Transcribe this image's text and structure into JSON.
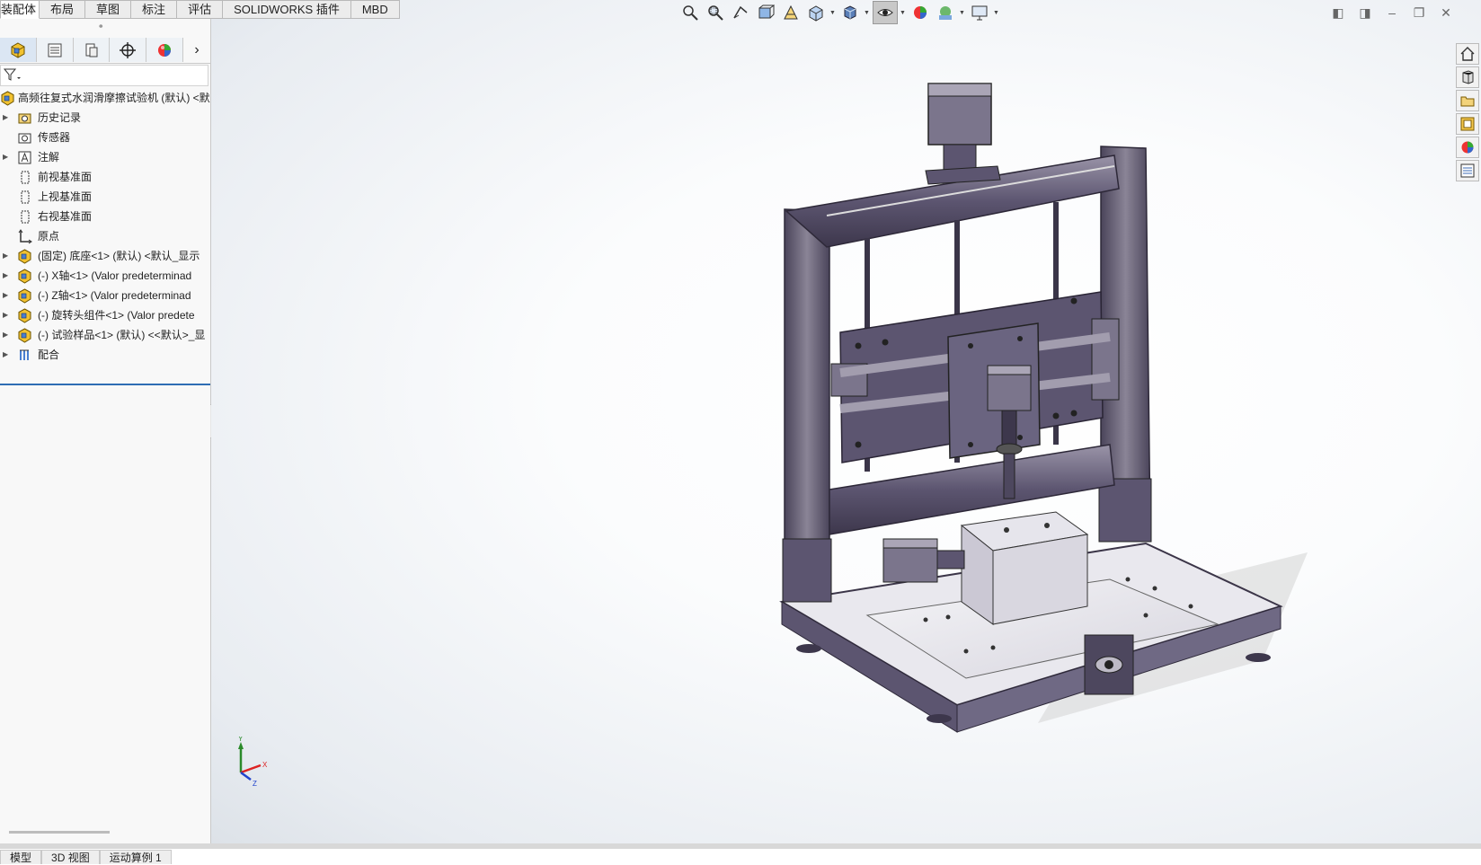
{
  "command_tabs": [
    "装配体",
    "布局",
    "草图",
    "标注",
    "评估",
    "SOLIDWORKS 插件",
    "MBD"
  ],
  "panel_tabs": [
    {
      "name": "feature-manager",
      "icon": "assembly-icon"
    },
    {
      "name": "property-manager",
      "icon": "property-list-icon"
    },
    {
      "name": "configuration-manager",
      "icon": "configuration-icon"
    },
    {
      "name": "dimxpert-manager",
      "icon": "crosshair-icon"
    },
    {
      "name": "display-manager",
      "icon": "appearance-sphere-icon"
    }
  ],
  "tree": {
    "root": "高频往复式水润滑摩擦试验机 (默认) <默",
    "items": [
      {
        "label": "历史记录",
        "icon": "history-folder-icon",
        "expandable": true
      },
      {
        "label": "传感器",
        "icon": "sensor-folder-icon",
        "expandable": false
      },
      {
        "label": "注解",
        "icon": "annotation-icon",
        "expandable": true
      },
      {
        "label": "前视基准面",
        "icon": "plane-icon",
        "expandable": false
      },
      {
        "label": "上视基准面",
        "icon": "plane-icon",
        "expandable": false
      },
      {
        "label": "右视基准面",
        "icon": "plane-icon",
        "expandable": false
      },
      {
        "label": "原点",
        "icon": "origin-icon",
        "expandable": false
      },
      {
        "label": "(固定) 底座<1> (默认) <默认_显示",
        "icon": "component-icon",
        "expandable": true
      },
      {
        "label": "(-) X轴<1> (Valor predeterminad",
        "icon": "component-icon",
        "expandable": true
      },
      {
        "label": "(-) Z轴<1> (Valor predeterminad",
        "icon": "component-icon",
        "expandable": true
      },
      {
        "label": "(-) 旋转头组件<1> (Valor predete",
        "icon": "component-icon",
        "expandable": true
      },
      {
        "label": "(-) 试验样品<1> (默认) <<默认>_显",
        "icon": "component-icon",
        "expandable": true
      },
      {
        "label": "配合",
        "icon": "mates-icon",
        "expandable": true
      }
    ]
  },
  "bottom_tabs": [
    "模型",
    "3D 视图",
    "运动算例 1"
  ],
  "triad": {
    "y": "Y",
    "x": "X",
    "z": "Z"
  },
  "colors": {
    "part": "#5c5570",
    "frame": "#8a8496",
    "accent": "#2e6db4"
  }
}
